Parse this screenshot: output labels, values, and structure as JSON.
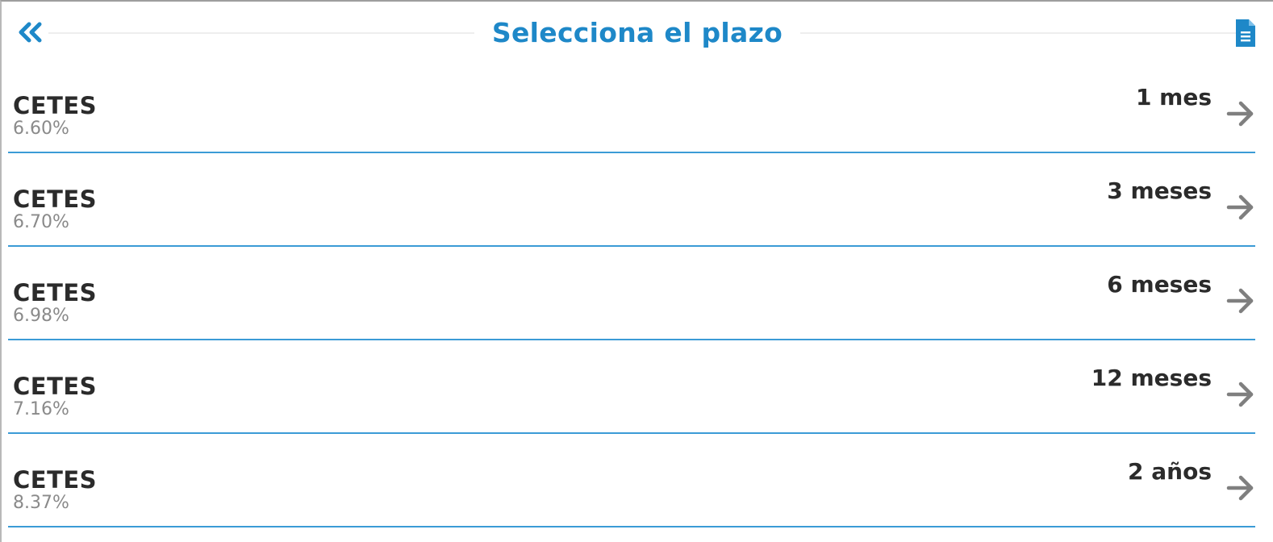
{
  "header": {
    "title": "Selecciona el plazo",
    "back_icon": "double-chevron-left-icon",
    "doc_icon": "document-icon"
  },
  "colors": {
    "accent": "#1e88c8",
    "divider": "#3b9bd6",
    "text": "#2b2b2b",
    "muted": "#8a8a8a",
    "arrow": "#7f7f7f"
  },
  "options": [
    {
      "name": "CETES",
      "rate": "6.60%",
      "term": "1 mes"
    },
    {
      "name": "CETES",
      "rate": "6.70%",
      "term": "3 meses"
    },
    {
      "name": "CETES",
      "rate": "6.98%",
      "term": "6 meses"
    },
    {
      "name": "CETES",
      "rate": "7.16%",
      "term": "12 meses"
    },
    {
      "name": "CETES",
      "rate": "8.37%",
      "term": "2 años"
    }
  ]
}
